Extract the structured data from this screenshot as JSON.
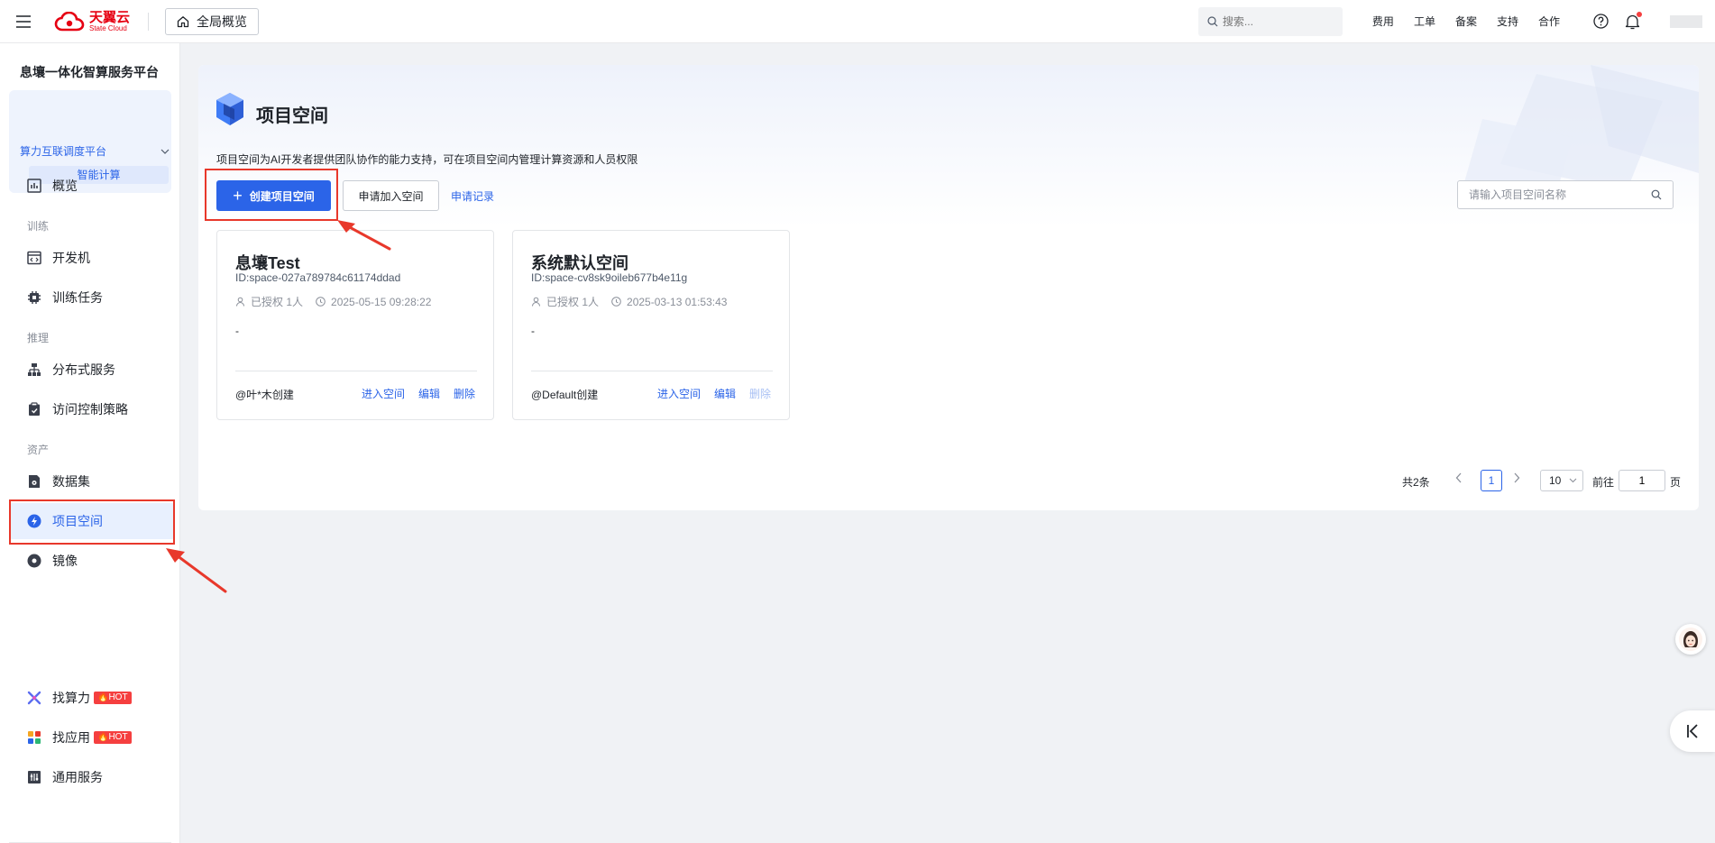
{
  "header": {
    "logo_cn": "天翼云",
    "logo_en": "State Cloud",
    "overview_label": "全局概览",
    "search_placeholder": "搜索...",
    "links": [
      "费用",
      "工单",
      "备案",
      "支持",
      "合作"
    ]
  },
  "sidebar": {
    "platform_title": "息壤一体化智算服务平台",
    "platform_select": "算力互联调度平台",
    "platform_sub": "智能计算",
    "items": [
      {
        "label": "概览"
      },
      {
        "group": "训练"
      },
      {
        "label": "开发机"
      },
      {
        "label": "训练任务"
      },
      {
        "group": "推理"
      },
      {
        "label": "分布式服务"
      },
      {
        "label": "访问控制策略"
      },
      {
        "group": "资产"
      },
      {
        "label": "数据集"
      },
      {
        "label": "项目空间"
      },
      {
        "label": "镜像"
      }
    ],
    "bottom_items": [
      {
        "label": "找算力",
        "badge": "HOT"
      },
      {
        "label": "找应用",
        "badge": "HOT"
      },
      {
        "label": "通用服务"
      }
    ]
  },
  "main": {
    "title": "项目空间",
    "description": "项目空间为AI开发者提供团队协作的能力支持，可在项目空间内管理计算资源和人员权限",
    "create_label": "创建项目空间",
    "join_label": "申请加入空间",
    "record_label": "申请记录",
    "search_placeholder": "请输入项目空间名称",
    "spaces": [
      {
        "name": "息壤Test",
        "id": "ID:space-027a789784c61174ddad",
        "authorized": "已授权 1人",
        "time": "2025-05-15 09:28:22",
        "desc": "-",
        "creator": "@叶*木创建",
        "actions": [
          "进入空间",
          "编辑",
          "删除"
        ]
      },
      {
        "name": "系统默认空间",
        "id": "ID:space-cv8sk9oileb677b4e11g",
        "authorized": "已授权 1人",
        "time": "2025-03-13 01:53:43",
        "desc": "-",
        "creator": "@Default创建",
        "actions": [
          "进入空间",
          "编辑",
          "删除"
        ]
      }
    ],
    "pagination": {
      "total": "共2条",
      "current": "1",
      "page_size": "10",
      "goto_label": "前往",
      "goto_value": "1",
      "page_suffix": "页"
    }
  },
  "colors": {
    "primary": "#2b64e8",
    "brand_red": "#e60012",
    "annotation": "#e8382b",
    "hot_badge": "#f53f3f"
  }
}
